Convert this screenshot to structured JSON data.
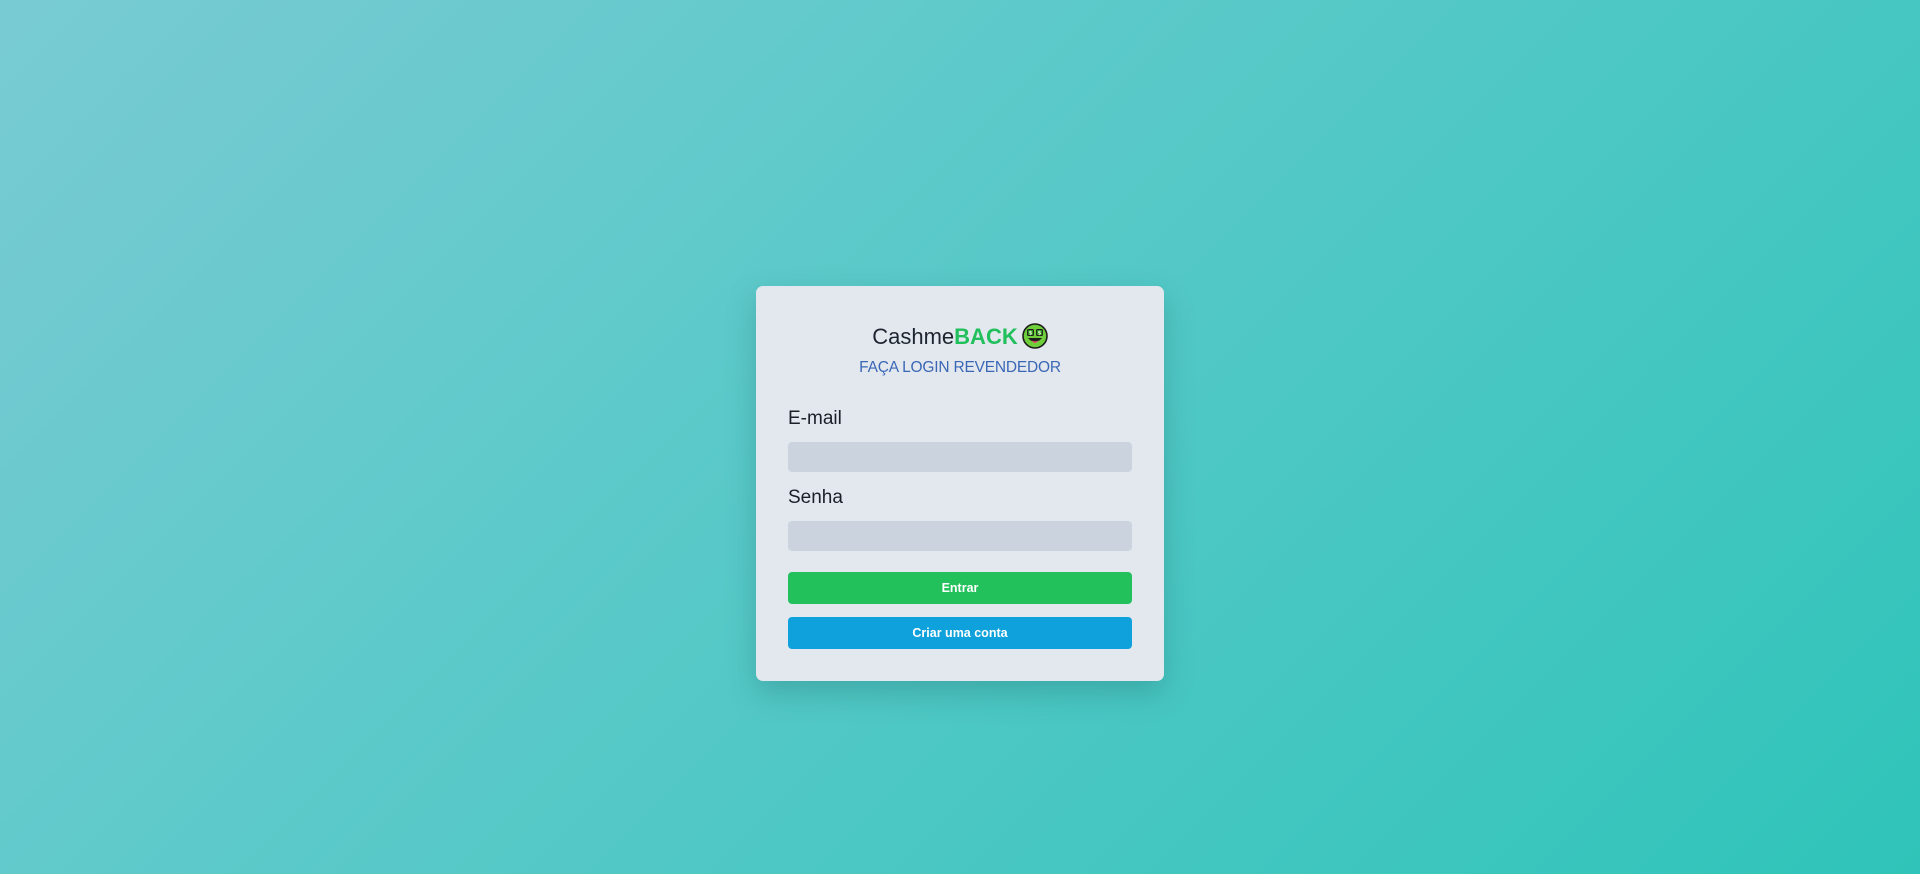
{
  "brand": {
    "name_plain": "Cashme",
    "name_accent": "BACK",
    "emoji_icon": "money-mouth-face-icon",
    "accent_color": "#22c05d"
  },
  "subtitle": "FAÇA LOGIN REVENDEDOR",
  "form": {
    "email_label": "E-mail",
    "email_value": "",
    "email_placeholder": "",
    "password_label": "Senha",
    "password_value": "",
    "password_placeholder": "",
    "login_button": "Entrar",
    "create_account_button": "Criar uma conta"
  },
  "colors": {
    "login_button": "#23c15c",
    "create_account_button": "#0ea1dc",
    "subtitle": "#3a67b5",
    "card_background": "#e3e8ef"
  }
}
